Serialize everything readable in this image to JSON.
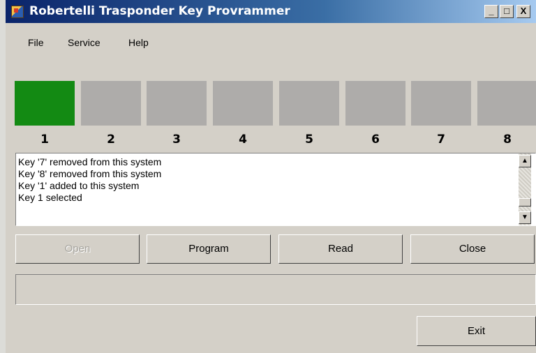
{
  "window": {
    "title": "Robertelli Trasponder Key Provrammer",
    "minimize_glyph": "_",
    "maximize_glyph": "□",
    "close_glyph": "X"
  },
  "menu": {
    "items": [
      {
        "label": "File"
      },
      {
        "label": "Service"
      },
      {
        "label": "Help"
      }
    ]
  },
  "keys": {
    "active_color": "#138a13",
    "inactive_color": "#aeacaa",
    "slots": [
      {
        "number": "1",
        "active": true
      },
      {
        "number": "2",
        "active": false
      },
      {
        "number": "3",
        "active": false
      },
      {
        "number": "4",
        "active": false
      },
      {
        "number": "5",
        "active": false
      },
      {
        "number": "6",
        "active": false
      },
      {
        "number": "7",
        "active": false
      },
      {
        "number": "8",
        "active": false
      }
    ]
  },
  "log": {
    "lines": [
      "Key '7' removed from this system",
      "Key '8' removed from this system",
      "Key '1' added to this system",
      "Key 1 selected"
    ],
    "scroll_up_glyph": "▲",
    "scroll_down_glyph": "▼"
  },
  "actions": {
    "open_label": "Open",
    "program_label": "Program",
    "read_label": "Read",
    "close_label": "Close"
  },
  "status": {
    "text": ""
  },
  "footer": {
    "exit_label": "Exit"
  }
}
